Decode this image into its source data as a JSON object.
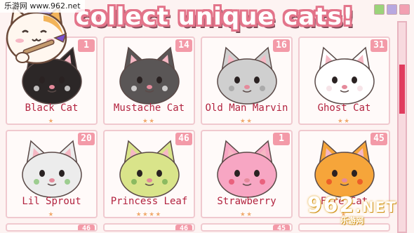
{
  "watermark": {
    "top_left": "乐游网 www.962.net",
    "bottom_main": "962",
    "bottom_suffix": ".NET",
    "bottom_sub": "乐游网"
  },
  "header": {
    "title": "collect unique cats!"
  },
  "cats": [
    {
      "name": "Black Cat",
      "count": "1",
      "stars": "★",
      "fur": "#2c2727",
      "accent": "#ffffff"
    },
    {
      "name": "Mustache Cat",
      "count": "14",
      "stars": "★★",
      "fur": "#5a5656",
      "accent": "#ffffff"
    },
    {
      "name": "Old Man Marvin",
      "count": "16",
      "stars": "★★",
      "fur": "#cfcfcf",
      "accent": "#9a9a9a"
    },
    {
      "name": "Ghost Cat",
      "count": "31",
      "stars": "★★",
      "fur": "#ffffff",
      "accent": "#f2d9de"
    },
    {
      "name": "Lil Sprout",
      "count": "20",
      "stars": "★",
      "fur": "#ececec",
      "accent": "#7cc06a"
    },
    {
      "name": "Princess Leaf",
      "count": "46",
      "stars": "★★★★",
      "fur": "#d9e48a",
      "accent": "#6aa84f"
    },
    {
      "name": "Strawberry",
      "count": "1",
      "stars": "★★",
      "fur": "#f7a6c3",
      "accent": "#e2445f"
    },
    {
      "name": "Fire Cat",
      "count": "45",
      "stars": "★",
      "fur": "#f6a53a",
      "accent": "#e8401f"
    }
  ],
  "partial_counts": [
    "46",
    "46",
    "45"
  ]
}
